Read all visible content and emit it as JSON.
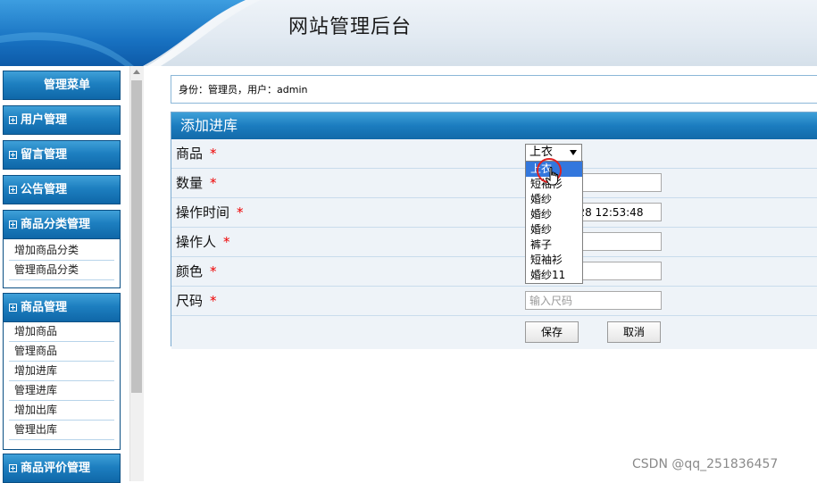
{
  "header": {
    "title": "网站管理后台"
  },
  "sidebar": {
    "title": "管理菜单",
    "groups": [
      {
        "label": "用户管理"
      },
      {
        "label": "留言管理"
      },
      {
        "label": "公告管理"
      },
      {
        "label": "商品分类管理",
        "items": [
          "增加商品分类",
          "管理商品分类"
        ]
      },
      {
        "label": "商品管理",
        "items": [
          "增加商品",
          "管理商品",
          "增加进库",
          "管理进库",
          "增加出库",
          "管理出库"
        ]
      },
      {
        "label": "商品评价管理"
      }
    ]
  },
  "identity": {
    "text": "身份：管理员，用户：admin"
  },
  "form": {
    "title": "添加进库",
    "required_mark": "*",
    "fields": {
      "product": {
        "label": "商品",
        "selected": "上衣"
      },
      "quantity": {
        "label": "数量",
        "value": ""
      },
      "time": {
        "label": "操作时间",
        "value": "2022-03-28 12:53:48"
      },
      "operator": {
        "label": "操作人",
        "value": ""
      },
      "color": {
        "label": "颜色",
        "value": ""
      },
      "size": {
        "label": "尺码",
        "placeholder": "输入尺码"
      }
    },
    "save_label": "保存",
    "cancel_label": "取消"
  },
  "dropdown": {
    "options": [
      "上衣",
      "短袖衫",
      "婚纱",
      "婚纱",
      "婚纱",
      "裤子",
      "短袖衫",
      "婚纱11"
    ],
    "highlighted_index": 0
  },
  "watermark": "CSDN @qq_251836457",
  "colors": {
    "accent": "#1d7fc0",
    "required": "#ee0000",
    "selection": "#3377dd"
  }
}
